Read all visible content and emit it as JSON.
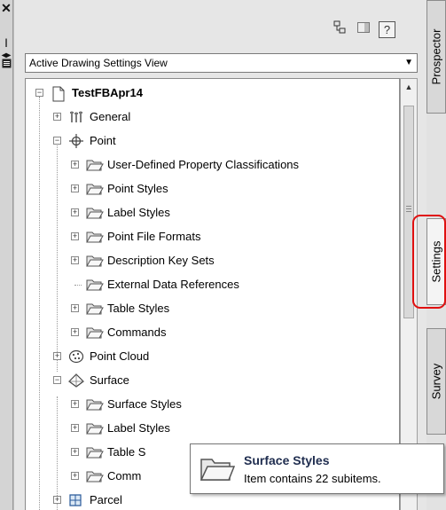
{
  "panel": {
    "view_selector": "Active Drawing Settings View"
  },
  "tree": [
    {
      "label": "TestFBApr14",
      "level": 0,
      "expander": "minus",
      "icon": "drawing-icon",
      "bold": true
    },
    {
      "label": "General",
      "level": 1,
      "expander": "plus",
      "icon": "general-icon"
    },
    {
      "label": "Point",
      "level": 1,
      "expander": "minus",
      "icon": "point-icon"
    },
    {
      "label": "User-Defined Property Classifications",
      "level": 2,
      "expander": "plus",
      "icon": "folder-icon"
    },
    {
      "label": "Point Styles",
      "level": 2,
      "expander": "plus",
      "icon": "folder-icon"
    },
    {
      "label": "Label Styles",
      "level": 2,
      "expander": "plus",
      "icon": "folder-icon"
    },
    {
      "label": "Point File Formats",
      "level": 2,
      "expander": "plus",
      "icon": "folder-icon"
    },
    {
      "label": "Description Key Sets",
      "level": 2,
      "expander": "plus",
      "icon": "folder-icon"
    },
    {
      "label": "External Data References",
      "level": 2,
      "expander": "none",
      "icon": "folder-icon"
    },
    {
      "label": "Table Styles",
      "level": 2,
      "expander": "plus",
      "icon": "folder-icon"
    },
    {
      "label": "Commands",
      "level": 2,
      "expander": "plus",
      "icon": "folder-icon"
    },
    {
      "label": "Point Cloud",
      "level": 1,
      "expander": "plus",
      "icon": "point-cloud-icon"
    },
    {
      "label": "Surface",
      "level": 1,
      "expander": "minus",
      "icon": "surface-icon"
    },
    {
      "label": "Surface Styles",
      "level": 2,
      "expander": "plus",
      "icon": "folder-icon"
    },
    {
      "label": "Label Styles",
      "level": 2,
      "expander": "plus",
      "icon": "folder-icon"
    },
    {
      "label": "Table S",
      "level": 2,
      "expander": "plus",
      "icon": "folder-icon"
    },
    {
      "label": "Comm",
      "level": 2,
      "expander": "plus",
      "icon": "folder-icon"
    },
    {
      "label": "Parcel",
      "level": 1,
      "expander": "plus",
      "icon": "parcel-icon"
    }
  ],
  "tabs": {
    "prospector": "Prospector",
    "settings": "Settings",
    "survey": "Survey"
  },
  "tooltip": {
    "title": "Surface Styles",
    "description": "Item contains 22 subitems."
  },
  "colors": {
    "highlight": "#e01010",
    "tooltip_title": "#1f2d4f"
  }
}
